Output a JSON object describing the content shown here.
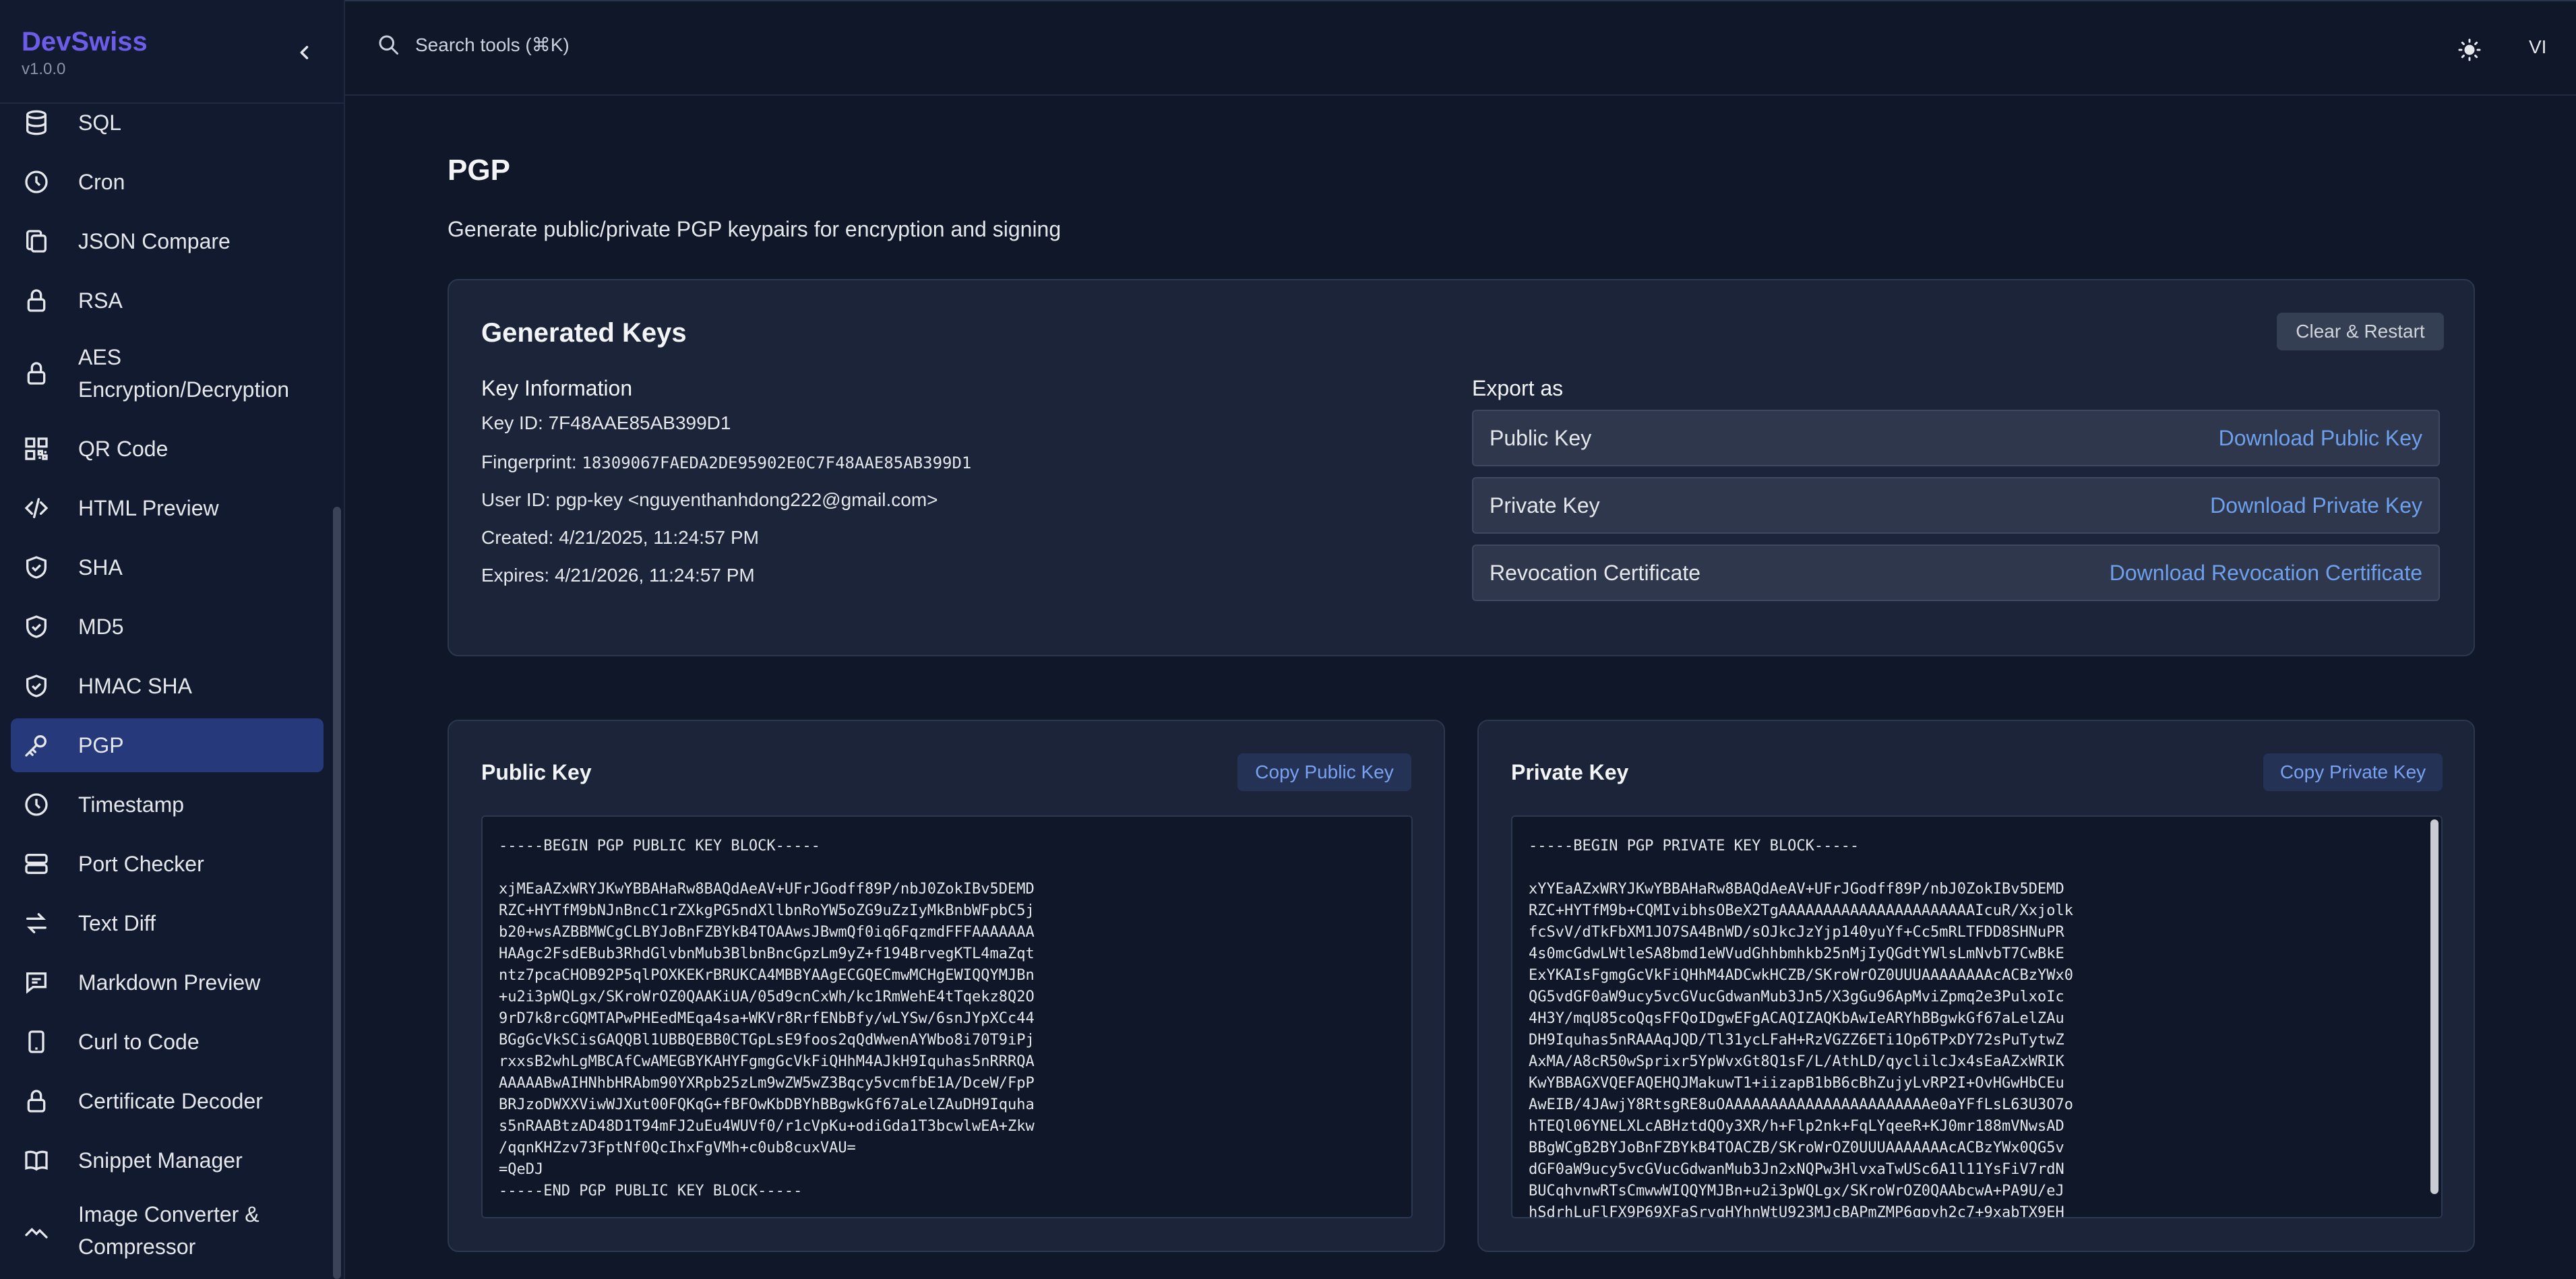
{
  "app": {
    "name": "DevSwiss",
    "version": "v1.0.0"
  },
  "sidebar": {
    "items": [
      {
        "label": "SQL",
        "icon": "database-icon",
        "active": false
      },
      {
        "label": "Cron",
        "icon": "clock-icon",
        "active": false
      },
      {
        "label": "JSON Compare",
        "icon": "copy-icon",
        "active": false
      },
      {
        "label": "RSA",
        "icon": "lock-icon",
        "active": false
      },
      {
        "label": "AES Encryption/Decryption",
        "icon": "lock-icon",
        "active": false
      },
      {
        "label": "QR Code",
        "icon": "qr-code-icon",
        "active": false
      },
      {
        "label": "HTML Preview",
        "icon": "code-icon",
        "active": false
      },
      {
        "label": "SHA",
        "icon": "shield-check-icon",
        "active": false
      },
      {
        "label": "MD5",
        "icon": "shield-check-icon",
        "active": false
      },
      {
        "label": "HMAC SHA",
        "icon": "shield-check-icon",
        "active": false
      },
      {
        "label": "PGP",
        "icon": "key-icon",
        "active": true
      },
      {
        "label": "Timestamp",
        "icon": "clock-icon",
        "active": false
      },
      {
        "label": "Port Checker",
        "icon": "server-icon",
        "active": false
      },
      {
        "label": "Text Diff",
        "icon": "arrows-swap-icon",
        "active": false
      },
      {
        "label": "Markdown Preview",
        "icon": "message-square-icon",
        "active": false
      },
      {
        "label": "Curl to Code",
        "icon": "smartphone-icon",
        "active": false
      },
      {
        "label": "Certificate Decoder",
        "icon": "lock-icon",
        "active": false
      },
      {
        "label": "Snippet Manager",
        "icon": "book-icon",
        "active": false
      },
      {
        "label": "Image Converter & Compressor",
        "icon": "image-wave-icon",
        "active": false
      }
    ]
  },
  "topbar": {
    "search_label": "Search tools (⌘K)",
    "language": "VI"
  },
  "page": {
    "title": "PGP",
    "description": "Generate public/private PGP keypairs for encryption and signing"
  },
  "generated": {
    "title": "Generated Keys",
    "clear_label": "Clear & Restart",
    "info_title": "Key Information",
    "key_id_label": "Key ID:",
    "key_id": "7F48AAE85AB399D1",
    "fingerprint_label": "Fingerprint:",
    "fingerprint": "18309067FAEDA2DE95902E0C7F48AAE85AB399D1",
    "user_id_label": "User ID:",
    "user_id": "pgp-key <nguyenthanhdong222@gmail.com>",
    "created_label": "Created:",
    "created": "4/21/2025, 11:24:57 PM",
    "expires_label": "Expires:",
    "expires": "4/21/2026, 11:24:57 PM",
    "export_title": "Export as",
    "exports": [
      {
        "label": "Public Key",
        "action": "Download Public Key"
      },
      {
        "label": "Private Key",
        "action": "Download Private Key"
      },
      {
        "label": "Revocation Certificate",
        "action": "Download Revocation Certificate"
      }
    ]
  },
  "public_key": {
    "title": "Public Key",
    "copy_label": "Copy Public Key",
    "text": "-----BEGIN PGP PUBLIC KEY BLOCK-----\n\nxjMEaAZxWRYJKwYBBAHaRw8BAQdAeAV+UFrJGodff89P/nbJ0ZokIBv5DEMD\nRZC+HYTfM9bNJnBncC1rZXkgPG5ndXllbnRoYW5oZG9uZzIyMkBnbWFpbC5j\nb20+wsAZBBMWCgCLBYJoBnFZBYkB4TOAAwsJBwmQf0iq6FqzmdFFFAAAAAAA\nHAAgc2FsdEBub3RhdGlvbnMub3BlbnBncGpzLm9yZ+f194BrvegKTL4maZqt\nntz7pcaCHOB92P5qlPOXKEKrBRUKCA4MBBYAAgECGQECmwMCHgEWIQQYMJBn\n+u2i3pWQLgx/SKroWrOZ0QAAKiUA/05d9cnCxWh/kc1RmWehE4tTqekz8Q2O\n9rD7k8rcGQMTAPwPHEedMEqa4sa+WKVr8RrfENbBfy/wLYSw/6snJYpXCc44\nBGgGcVkSCisGAQQBl1UBBQEBB0CTGpLsE9foos2qQdWwenAYWbo8i70T9iPj\nrxxsB2whLgMBCAfCwAMEGBYKAHYFgmgGcVkFiQHhM4AJkH9Iquhas5nRRRQA\nAAAAABwAIHNhbHRAbm90YXRpb25zLm9wZW5wZ3Bqcy5vcmfbE1A/DceW/FpP\nBRJzoDWXXViwWJXut00FQKqG+fBFOwKbDBYhBBgwkGf67aLelZAuDH9Iquha\ns5nRAABtzAD48D1T94mFJ2uEu4WUVf0/r1cVpKu+odiGda1T3bcwlwEA+Zkw\n/qqnKHZzv73FptNf0QcIhxFgVMh+c0ub8cuxVAU=\n=QeDJ\n-----END PGP PUBLIC KEY BLOCK-----"
  },
  "private_key": {
    "title": "Private Key",
    "copy_label": "Copy Private Key",
    "text": "-----BEGIN PGP PRIVATE KEY BLOCK-----\n\nxYYEaAZxWRYJKwYBBAHaRw8BAQdAeAV+UFrJGodff89P/nbJ0ZokIBv5DEMD\nRZC+HYTfM9b+CQMIvibhsOBeX2TgAAAAAAAAAAAAAAAAAAAAAAIcuR/Xxjolk\nfcSvV/dTkFbXM1JO7SA4BnWD/sOJkcJzYjp140yuYf+Cc5mRLTFDD8SHNuPR\n4s0mcGdwLWtleSA8bmd1eWVudGhhbmhkb25nMjIyQGdtYWlsLmNvbT7CwBkE\nExYKAIsFgmgGcVkFiQHhM4ADCwkHCZB/SKroWrOZ0UUUAAAAAAAAcACBzYWx0\nQG5vdGF0aW9ucy5vcGVucGdwanMub3Jn5/X3gGu96ApMviZpmq2e3PulxoIc\n4H3Y/mqU85coQqsFFQoIDgwEFgACAQIZAQKbAwIeARYhBBgwkGf67aLelZAu\nDH9Iquhas5nRAAAqJQD/Tl31ycLFaH+RzVGZZ6ETi1Op6TPxDY72sPuTytwZ\nAxMA/A8cR50wSprixr5YpWvxGt8Q1sF/L/AthLD/qyclilcJx4sEaAZxWRIK\nKwYBBAGXVQEFAQEHQJMakuwT1+iizapB1bB6cBhZujyLvRP2I+OvHGwHbCEu\nAwEIB/4JAwjY8RtsgRE8uOAAAAAAAAAAAAAAAAAAAAAAAe0aYFfLsL63U3O7o\nhTEQl06YNELXLcABHztdQOy3XR/h+Flp2nk+FqLYqeeR+KJ0mr188mVNwsAD\nBBgWCgB2BYJoBnFZBYkB4TOACZB/SKroWrOZ0UUUAAAAAAAcACBzYWx0QG5v\ndGF0aW9ucy5vcGVucGdwanMub3Jn2xNQPw3HlvxaTwUSc6A1l11YsFiV7rdN\nBUCqhvnwRTsCmwwWIQQYMJBn+u2i3pWQLgx/SKroWrOZ0QAAbcwA+PA9U/eJ\nhSdrhLuFlFX9P69XFaSrvqHYhnWtU923MJcBAPmZMP6qpyh2c7+9xabTX9EH"
  }
}
